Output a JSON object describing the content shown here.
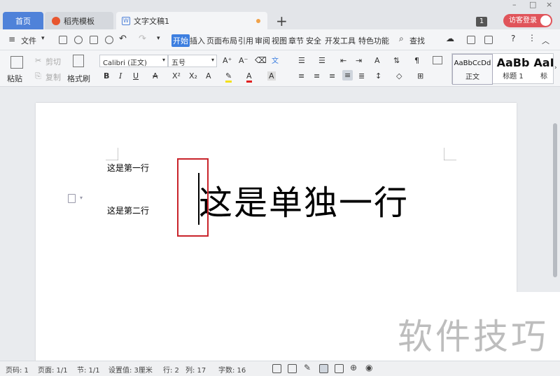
{
  "tabs": {
    "home": "首页",
    "template": "稻壳模板",
    "document": "文字文稿1",
    "new_tab": "+"
  },
  "window": {
    "badge": "1",
    "login": "访客登录",
    "minimize": "–",
    "maximize": "□",
    "close": "×"
  },
  "menu": {
    "file": "文件",
    "items": [
      "开始",
      "插入",
      "页面布局",
      "引用",
      "审阅",
      "视图",
      "章节",
      "安全",
      "开发工具",
      "特色功能"
    ],
    "search": "查找"
  },
  "ribbon": {
    "paste": "粘贴",
    "cut": "剪切",
    "copy": "复制",
    "format_painter": "格式刷",
    "font_name": "Calibri (正文)",
    "font_size": "五号",
    "bold": "B",
    "italic": "I",
    "underline": "U",
    "styles": [
      {
        "preview": "AaBbCcDd",
        "label": "正文"
      },
      {
        "preview": "AaBb",
        "label": "标题 1"
      },
      {
        "preview": "AaI",
        "label": "标"
      }
    ]
  },
  "document": {
    "line1": "这是第一行",
    "line2": "这是第二行",
    "big_line": "这是单独一行"
  },
  "watermark": "软件技巧",
  "status": {
    "page_num": "页码: 1",
    "page": "页面: 1/1",
    "section": "节: 1/1",
    "setting": "设置值: 3厘米",
    "row": "行: 2",
    "col": "列: 17",
    "words": "字数: 16"
  },
  "colors": {
    "accent": "#3d7fe0",
    "highlight_box": "#c9242b",
    "login": "#e0545a"
  }
}
